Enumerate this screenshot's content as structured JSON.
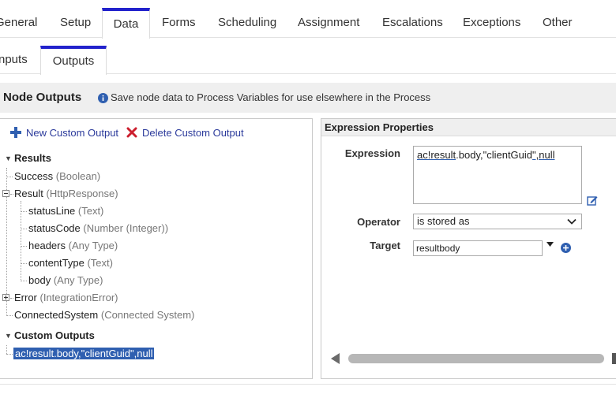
{
  "tabs": [
    {
      "label": "General"
    },
    {
      "label": "Setup"
    },
    {
      "label": "Data"
    },
    {
      "label": "Forms"
    },
    {
      "label": "Scheduling"
    },
    {
      "label": "Assignment"
    },
    {
      "label": "Escalations"
    },
    {
      "label": "Exceptions"
    },
    {
      "label": "Other"
    }
  ],
  "active_tab": "Data",
  "subtabs": [
    {
      "label": "nputs"
    },
    {
      "label": "Outputs"
    }
  ],
  "active_subtab": "Outputs",
  "section": {
    "title": "Node Outputs",
    "info_text": "Save node data to Process Variables for use elsewhere in the Process"
  },
  "toolbar": {
    "new_label": "New Custom Output",
    "delete_label": "Delete Custom Output"
  },
  "tree": {
    "results_label": "Results",
    "items": [
      {
        "name": "Success",
        "type": "(Boolean)"
      },
      {
        "name": "Result",
        "type": "(HttpResponse)"
      },
      {
        "name": "statusLine",
        "type": "(Text)"
      },
      {
        "name": "statusCode",
        "type": "(Number (Integer))"
      },
      {
        "name": "headers",
        "type": "(Any Type)"
      },
      {
        "name": "contentType",
        "type": "(Text)"
      },
      {
        "name": "body",
        "type": "(Any Type)"
      },
      {
        "name": "Error",
        "type": "(IntegrationError)"
      },
      {
        "name": "ConnectedSystem",
        "type": "(Connected System)"
      }
    ],
    "custom_label": "Custom Outputs",
    "custom_items": [
      {
        "name": "ac!result.body,\"clientGuid\",null"
      }
    ]
  },
  "expression_panel": {
    "title": "Expression Properties",
    "expression_label": "Expression",
    "expression_parts": [
      "ac!result",
      ".body,\"clientGuid",
      "\",null"
    ],
    "operator_label": "Operator",
    "operator_value": "is stored as",
    "target_label": "Target",
    "target_value": "resultbody"
  },
  "colors": {
    "accent": "#2222cc",
    "link": "#2b3a9b",
    "delete": "#cc1f2e",
    "selection": "#2f5fb0"
  },
  "icons": [
    "info-icon",
    "plus-icon",
    "delete-x-icon",
    "edit-icon",
    "chevron-down-icon",
    "add-circle-icon",
    "scroll-left-icon"
  ]
}
